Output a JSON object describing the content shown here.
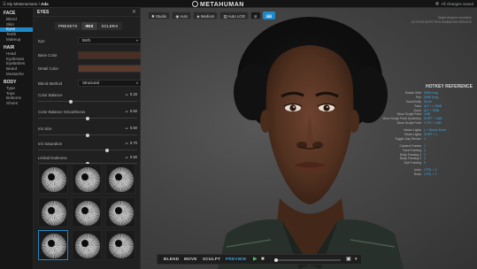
{
  "topbar": {
    "breadcrumb_root": "My MetaHumans",
    "breadcrumb_sep": "/",
    "breadcrumb_current": "Ada",
    "logo_text": "METAHUMAN",
    "status": "All changes saved"
  },
  "sidebar": {
    "sections": [
      {
        "title": "FACE",
        "items": [
          "Blend",
          "Skin",
          "Eyes",
          "Teeth",
          "Makeup"
        ],
        "active": "Eyes"
      },
      {
        "title": "HAIR",
        "items": [
          "Head",
          "Eyebrows",
          "Eyelashes",
          "Beard",
          "Mustache"
        ]
      },
      {
        "title": "BODY",
        "items": [
          "Type",
          "Tops",
          "Bottoms",
          "Shoes"
        ]
      }
    ]
  },
  "panel": {
    "title": "EYES",
    "close_icon": "close-icon",
    "tabs": [
      "PRESETS",
      "IRIS",
      "SCLERA"
    ],
    "active_tab": "IRIS",
    "eye_label": "Eye",
    "eye_value": "Both",
    "base_color_label": "Base Color",
    "base_color": "#4a2f24",
    "detail_color_label": "Detail Color",
    "detail_color": "#5a3a2c",
    "blend_method_label": "Blend Method",
    "blend_method_value": "Structural",
    "sliders": [
      {
        "label": "Color Balance",
        "value": "0.33",
        "fraction": 0.33
      },
      {
        "label": "Color Balance Smoothness",
        "value": "0.50",
        "fraction": 0.5
      },
      {
        "label": "Iris Size",
        "value": "0.50",
        "fraction": 0.5
      },
      {
        "label": "Iris Saturation",
        "value": "0.70",
        "fraction": 0.7
      },
      {
        "label": "Limbal Darkness",
        "value": "0.50",
        "fraction": 0.5
      }
    ],
    "iris_presets_count_visible": 9,
    "selected_preset_index": 6
  },
  "viewport": {
    "toolbar": [
      {
        "label": "Studio",
        "icon": "sun-icon"
      },
      {
        "label": "Auto",
        "icon": "camera-icon"
      },
      {
        "label": "Medium",
        "icon": "quality-icon"
      },
      {
        "label": "Auto LOD",
        "icon": "lod-icon"
      }
    ],
    "info_line_1": "Target viewport resolution",
    "info_line_2": "ACCESS DEPICTING ANIMATION REDUCE",
    "hotkeys_title": "HOTKEY REFERENCE",
    "hotkeys": [
      {
        "key": "Rotate Orbit",
        "value": "RMB Drag"
      },
      {
        "key": "Pan",
        "value": "MMB Drag"
      },
      {
        "key": "Zoom/Dolly",
        "value": "Scroll"
      },
      {
        "key": "Face",
        "value": "ALT + 1 RMB"
      },
      {
        "key": "Zoom",
        "value": "ALT + RMB"
      },
      {
        "key": "Move Sculpt Point",
        "value": "LMB"
      },
      {
        "key": "Move Sculpt Point Symmetry",
        "value": "SHIFT + LMB"
      },
      {
        "key": "Move Sculpt Point",
        "value": "CTRL + LMB"
      },
      {
        "key": "",
        "value": ""
      },
      {
        "key": "Viewer Lights",
        "value": "L + Mouse Move"
      },
      {
        "key": "Reset Lights",
        "value": "SHIFT + L"
      },
      {
        "key": "Toggle Clay Render",
        "value": "C"
      },
      {
        "key": "",
        "value": ""
      },
      {
        "key": "Camera Frames",
        "value": "1"
      },
      {
        "key": "Face Framing",
        "value": "2"
      },
      {
        "key": "Body Framing 1",
        "value": "3"
      },
      {
        "key": "Body Framing 2",
        "value": "4"
      },
      {
        "key": "Eye Framing",
        "value": "5"
      },
      {
        "key": "",
        "value": ""
      },
      {
        "key": "Undo",
        "value": "CTRL + Z"
      },
      {
        "key": "Redo",
        "value": "CTRL + Y"
      }
    ],
    "bottombar": {
      "modes": [
        "BLEND",
        "MOVE",
        "SCULPT",
        "PREVIEW"
      ],
      "active_mode": "PREVIEW"
    }
  },
  "colors": {
    "accent": "#1e88c8",
    "panel_bg": "#202020",
    "viewport_bg": "#4a4a4a"
  }
}
